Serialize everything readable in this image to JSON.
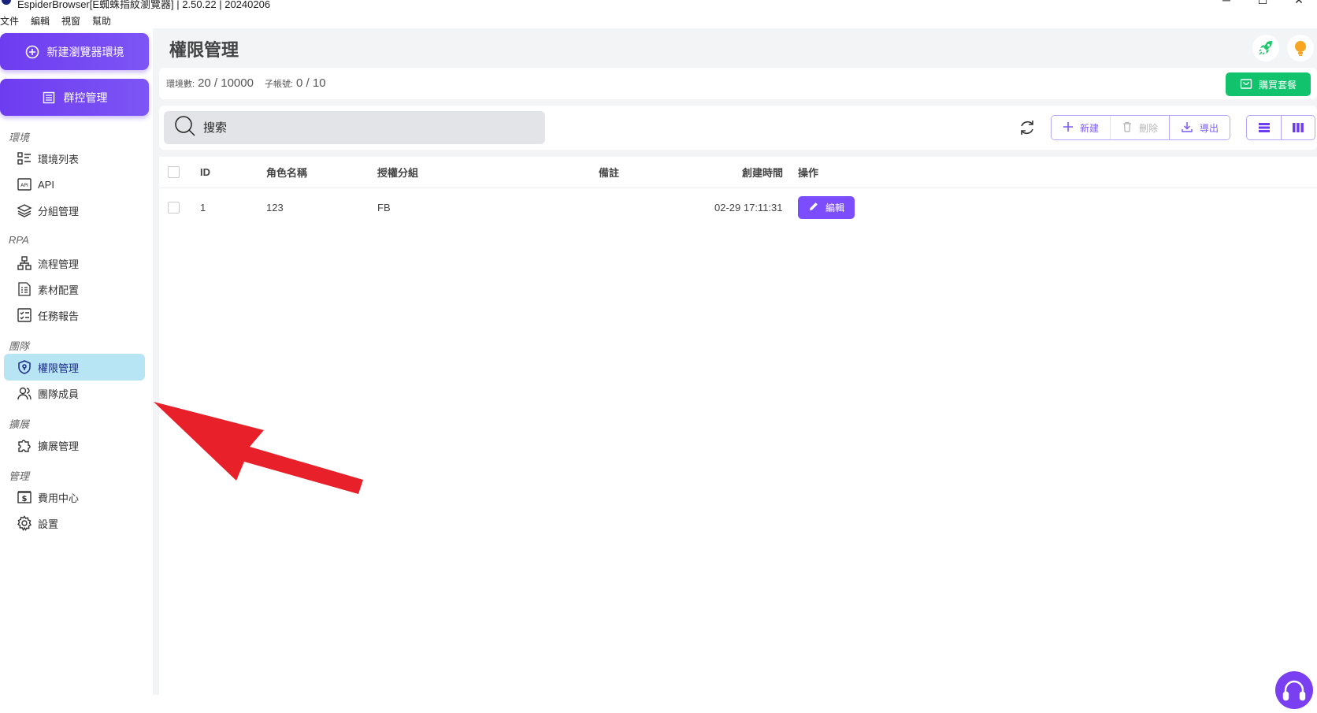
{
  "window": {
    "title": "EspiderBrowser[E蜘蛛指紋瀏覽器] | 2.50.22 | 20240206",
    "controls": [
      "─",
      "☐",
      "✕"
    ]
  },
  "menu": [
    "文件",
    "編輯",
    "視窗",
    "幫助"
  ],
  "sidebar": {
    "new_env_label": "新建瀏覽器環境",
    "group_ctrl_label": "群控管理",
    "sections": [
      {
        "title": "環境",
        "items": [
          {
            "label": "環境列表",
            "icon": "list-icon"
          },
          {
            "label": "API",
            "icon": "api-icon"
          },
          {
            "label": "分組管理",
            "icon": "layers-icon"
          }
        ]
      },
      {
        "title": "RPA",
        "items": [
          {
            "label": "流程管理",
            "icon": "flow-icon"
          },
          {
            "label": "素材配置",
            "icon": "material-icon"
          },
          {
            "label": "任務報告",
            "icon": "checklist-icon"
          }
        ]
      },
      {
        "title": "團隊",
        "items": [
          {
            "label": "權限管理",
            "icon": "shield-icon",
            "active": true
          },
          {
            "label": "團隊成員",
            "icon": "team-icon"
          }
        ]
      },
      {
        "title": "擴展",
        "items": [
          {
            "label": "擴展管理",
            "icon": "puzzle-icon"
          }
        ]
      },
      {
        "title": "管理",
        "items": [
          {
            "label": "費用中心",
            "icon": "billing-icon"
          },
          {
            "label": "設置",
            "icon": "gear-icon"
          }
        ]
      }
    ]
  },
  "header": {
    "title": "權限管理"
  },
  "stats": {
    "env_label": "環境數:",
    "env_value": "20 / 10000",
    "sub_label": "子帳號:",
    "sub_value": "0 / 10",
    "buy_label": "購買套餐"
  },
  "toolbar": {
    "search_placeholder": "搜索",
    "new_label": "新建",
    "delete_label": "刪除",
    "export_label": "導出"
  },
  "table": {
    "columns": [
      "ID",
      "角色名稱",
      "授權分組",
      "備註",
      "創建時間",
      "操作"
    ],
    "rows": [
      {
        "id": "1",
        "role": "123",
        "group": "FB",
        "note": "",
        "created": "02-29 17:11:31",
        "action": "編輯"
      }
    ]
  },
  "colors": {
    "accent": "#7c4dff",
    "buy": "#12c36e",
    "active_nav": "#b7e5f4",
    "arrow": "#e8202a"
  }
}
